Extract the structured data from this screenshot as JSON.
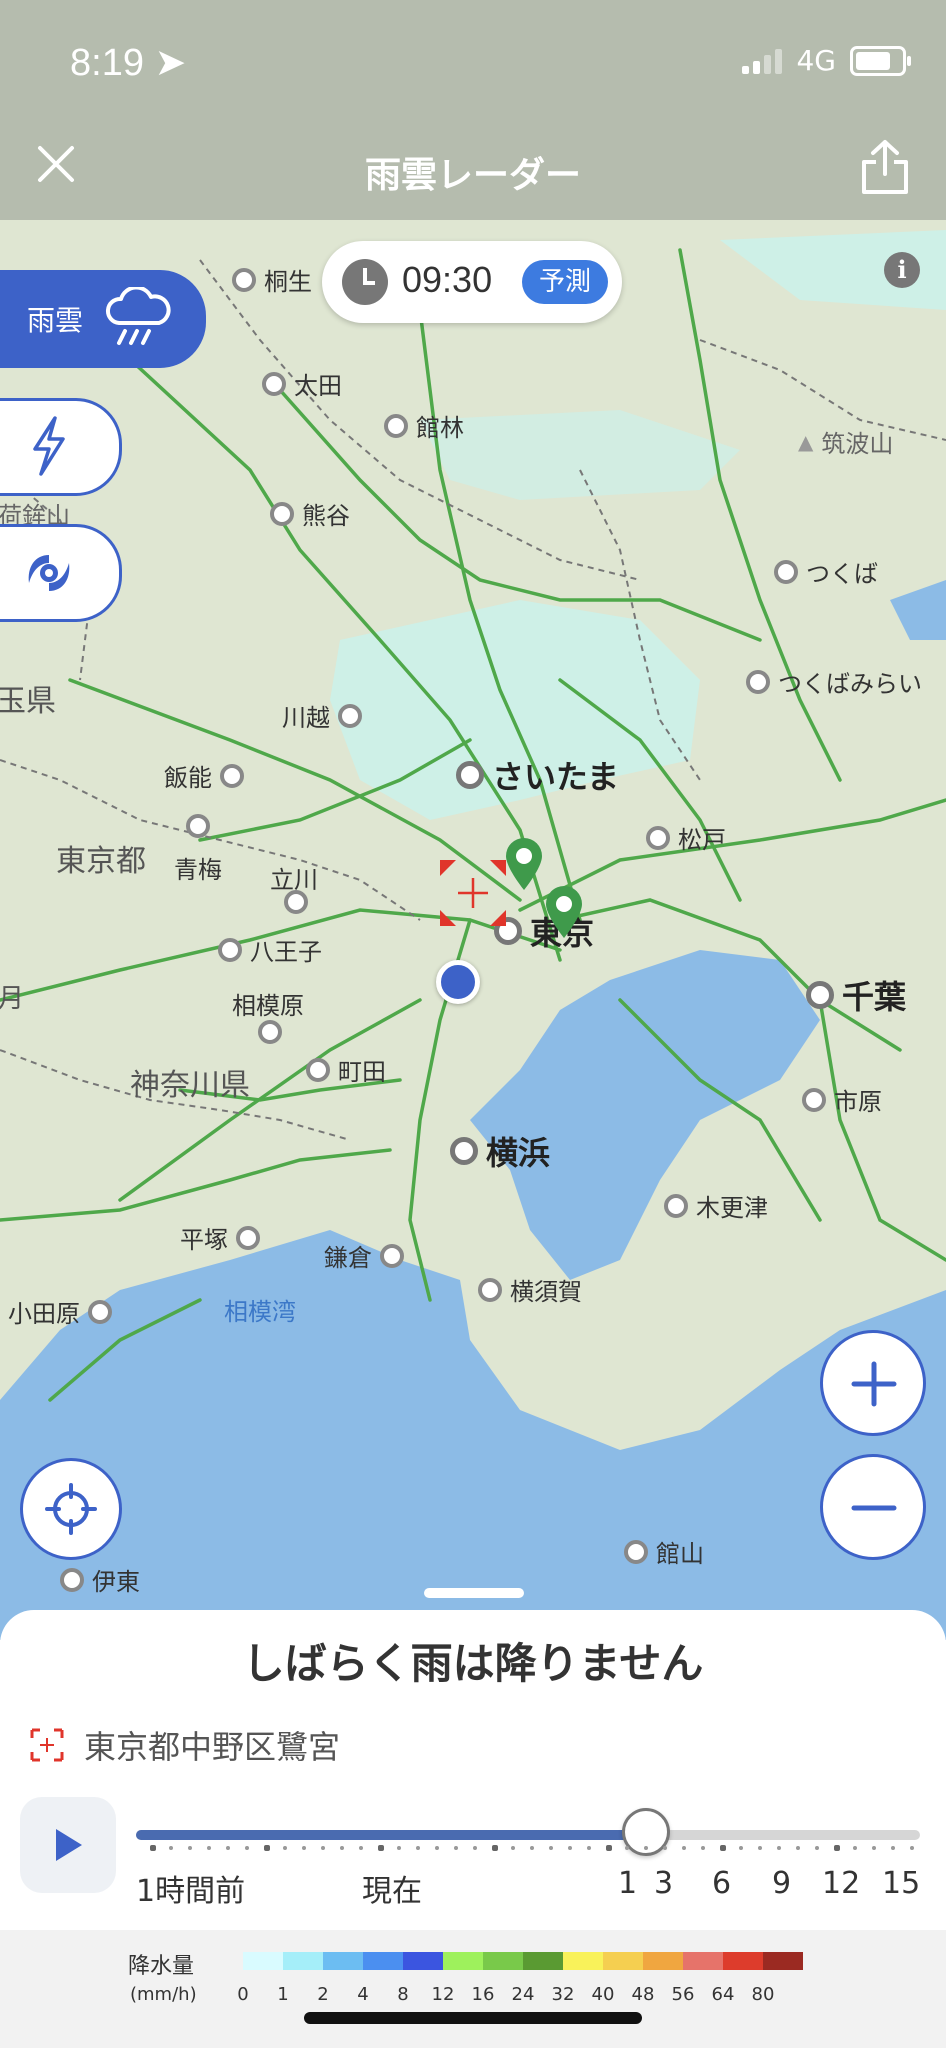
{
  "status_bar": {
    "time": "8:19",
    "network": "4G"
  },
  "header": {
    "title": "雨雲レーダー",
    "close_icon": "close-icon",
    "share_icon": "share-icon"
  },
  "map": {
    "time_pill": {
      "time": "09:30",
      "badge": "予測"
    },
    "layers": [
      {
        "label": "雨雲",
        "icon": "rain-cloud-icon",
        "active": true
      },
      {
        "label": "",
        "icon": "lightning-icon",
        "active": false
      },
      {
        "label": "",
        "icon": "typhoon-icon",
        "active": false
      }
    ],
    "info_label": "i",
    "places": {
      "kiryu": "桐生",
      "ota": "太田",
      "tatebayashi": "館林",
      "kumagaya": "熊谷",
      "tsukuba": "つくば",
      "tsukubamirai": "つくばみらい",
      "kawagoe": "川越",
      "saitama": "さいたま",
      "hanno": "飯能",
      "ome": "青梅",
      "matsudo": "松戸",
      "tachikawa": "立川",
      "hachioji": "八王子",
      "tokyo": "東京",
      "chiba": "千葉",
      "sagamihara": "相模原",
      "machida": "町田",
      "ichihara": "市原",
      "yokohama": "横浜",
      "kisarazu": "木更津",
      "hiratsuka": "平塚",
      "kamakura": "鎌倉",
      "yokosuka": "横須賀",
      "odawara": "小田原",
      "tateyama": "館山",
      "ito": "伊東",
      "tsukubasan": "筑波山"
    },
    "regions": {
      "tokyo_to": "東京都",
      "kanagawa": "神奈川県",
      "left_ken": "玉県",
      "left_tsuki": "月",
      "arasan": "荷鉾山"
    },
    "bay": "相模湾"
  },
  "sheet": {
    "headline": "しばらく雨は降りません",
    "location": "東京都中野区鷺宮",
    "slider": {
      "progress": 0.65,
      "labels": [
        "1時間前",
        "現在",
        "1",
        "3",
        "6",
        "9",
        "12",
        "15"
      ]
    }
  },
  "legend": {
    "title": "降水量",
    "unit": "(mm/h)",
    "values": [
      "0",
      "1",
      "2",
      "4",
      "8",
      "12",
      "16",
      "24",
      "32",
      "40",
      "48",
      "56",
      "64",
      "80"
    ],
    "colors": [
      "#d9fbff",
      "#a5eef9",
      "#6cbdf2",
      "#4b8ff0",
      "#3b55e0",
      "#9ef15c",
      "#79c94a",
      "#5a9a32",
      "#f9f25a",
      "#f5cf50",
      "#f0a640",
      "#e6736a",
      "#dd3c2c",
      "#9b2a22"
    ]
  }
}
